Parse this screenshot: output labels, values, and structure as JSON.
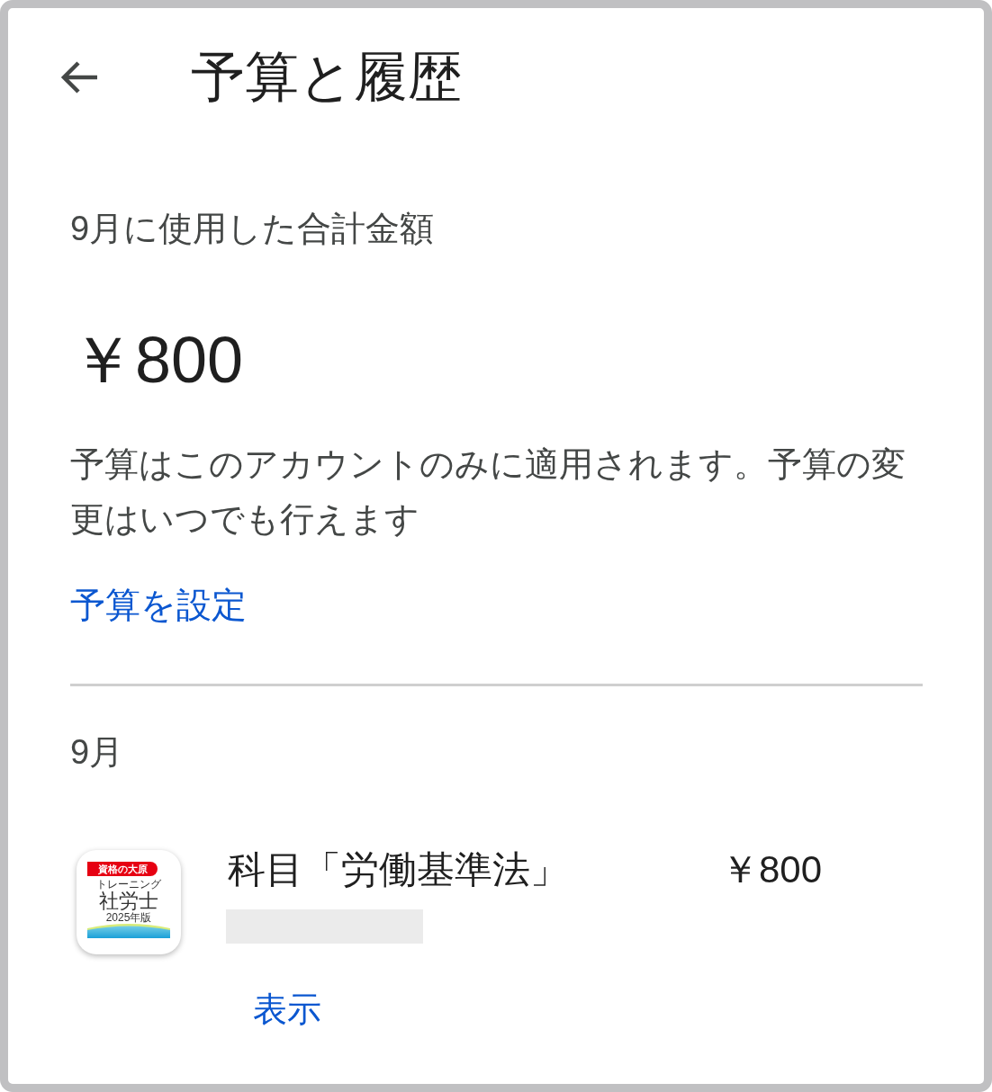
{
  "header": {
    "title": "予算と履歴"
  },
  "summary": {
    "label": "9月に使用した合計金額",
    "total": "￥800",
    "note": "予算はこのアカウントのみに適用されます。予算の変更はいつでも行えます",
    "link": "予算を設定"
  },
  "history": {
    "month": "9月",
    "items": [
      {
        "app_icon": {
          "brand": "資格の大原",
          "subtitle": "トレーニング",
          "name": "社労士",
          "edition": "2025年版"
        },
        "title": "科目「労働基準法」",
        "price": "￥800",
        "action": "表示"
      }
    ]
  }
}
